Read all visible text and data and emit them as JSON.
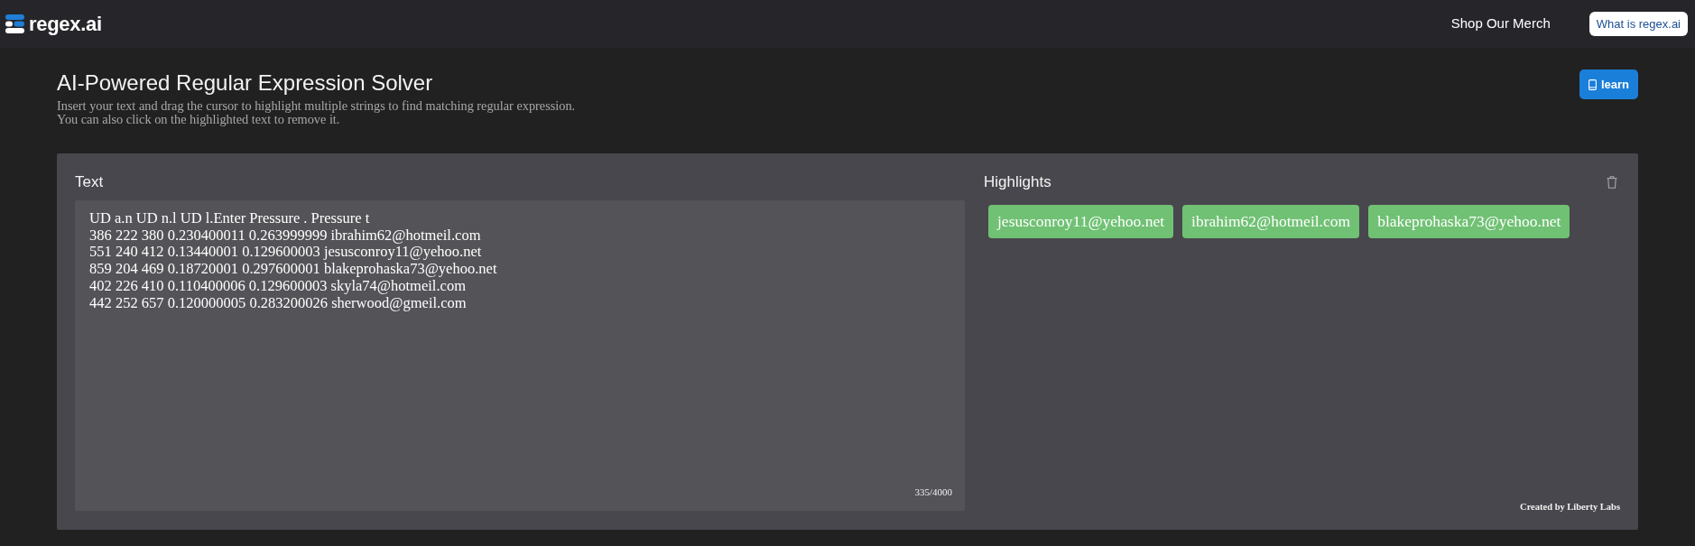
{
  "navbar": {
    "logo": "regex.ai",
    "links": [
      "Shop Our Merch"
    ],
    "button": "What is regex.ai"
  },
  "header": {
    "title": "AI-Powered Regular Expression Solver",
    "subtitle_lines": [
      "Insert your text and drag the cursor to highlight multiple strings to find matching regular expression.",
      "You can also click on the highlighted text to remove it."
    ],
    "learn_button": "learn"
  },
  "text_panel": {
    "label": "Text",
    "lines": [
      "UD a.n UD n.l UD l.Enter Pressure . Pressure t",
      "386 222 380 0.230400011 0.263999999 ibrahim62@hotmeil.com",
      "551 240 412 0.13440001 0.129600003 jesusconroy11@yehoo.net",
      "859 204 469 0.18720001 0.297600001 blakeprohaska73@yehoo.net",
      "402 226 410 0.110400006 0.129600003 skyla74@hotmeil.com",
      "442 252 657 0.120000005 0.283200026 sherwood@gmeil.com"
    ],
    "counter": "335/4000"
  },
  "highlights_panel": {
    "label": "Highlights",
    "items": [
      "jesusconroy11@yehoo.net",
      "ibrahim62@hotmeil.com",
      "blakeprohaska73@yehoo.net"
    ],
    "credit": "Created by Liberty Labs"
  }
}
